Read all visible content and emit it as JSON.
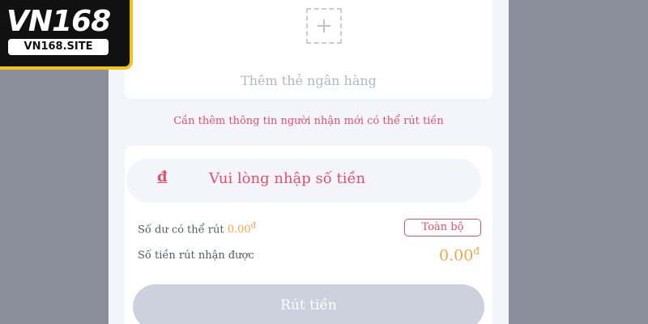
{
  "logo": {
    "main": "VN168",
    "sub": "VN168.SITE"
  },
  "add_card": {
    "icon": "plus-icon",
    "label": "Thêm thẻ ngân hàng"
  },
  "notice": "Cần thêm thông tin người nhận mới có thể rút tiền",
  "amount": {
    "currency_symbol": "đ",
    "placeholder": "Vui lòng nhập số tiền"
  },
  "balance": {
    "label": "Số dư có thể rút",
    "value": "0.00",
    "currency": "đ"
  },
  "all_button": "Toàn bộ",
  "received": {
    "label": "Số tiền rút nhận được",
    "value": "0.00",
    "currency": "đ"
  },
  "withdraw_button": "Rút tiền",
  "colors": {
    "accent": "#e0506a",
    "amount": "#f2a64a",
    "background": "#8a8f9b",
    "button_disabled": "#cdd0dd",
    "logo_gold": "#f0c419"
  }
}
